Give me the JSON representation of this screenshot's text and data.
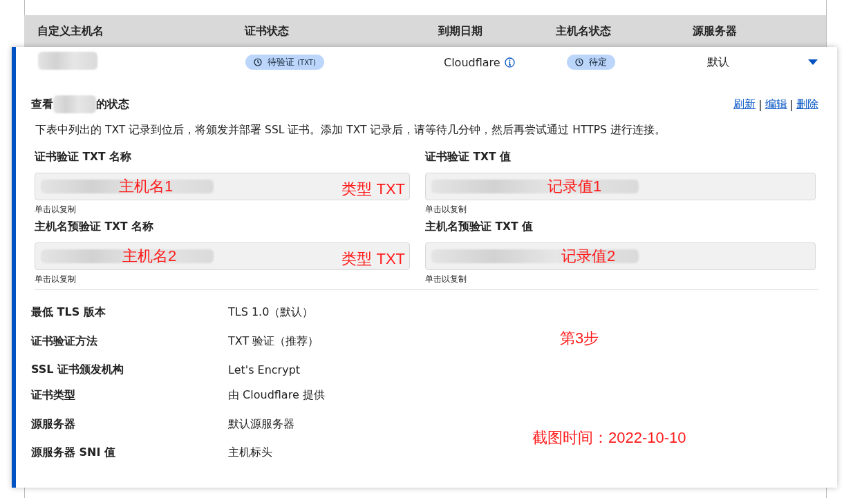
{
  "table": {
    "columns": [
      "自定义主机名",
      "证书状态",
      "到期日期",
      "主机名状态",
      "源服务器"
    ]
  },
  "row": {
    "cert_status": "待验证",
    "cert_status_suffix": "(TXT)",
    "expiry": "Cloudflare",
    "hostname_status": "待定",
    "origin": "默认",
    "expanded": true
  },
  "details": {
    "title_prefix": "查看",
    "title_suffix": "的状态",
    "actions": [
      "刷新",
      "编辑",
      "删除"
    ],
    "separator": "|",
    "description": "下表中列出的 TXT 记录到位后，将颁发并部署 SSL 证书。添加 TXT 记录后，请等待几分钟，然后再尝试通过 HTTPS 进行连接。",
    "fields": [
      {
        "label": "证书验证 TXT 名称",
        "note": "主机名1",
        "type_note": "类型 TXT",
        "hint": "单击以复制"
      },
      {
        "label": "证书验证 TXT 值",
        "note": "记录值1",
        "hint": "单击以复制"
      },
      {
        "label": "主机名预验证 TXT 名称",
        "note": "主机名2",
        "type_note": "类型 TXT",
        "hint": "单击以复制"
      },
      {
        "label": "主机名预验证 TXT 值",
        "note": "记录值2",
        "hint": "单击以复制"
      }
    ],
    "info": [
      {
        "label": "最低 TLS 版本",
        "value": "TLS 1.0（默认）"
      },
      {
        "label": "证书验证方法",
        "value": "TXT 验证（推荐）",
        "note": "第3步"
      },
      {
        "label": "SSL 证书颁发机构",
        "value": "Let's Encrypt"
      },
      {
        "label": "证书类型",
        "value": "由 Cloudflare 提供"
      },
      {
        "label": "源服务器",
        "value": "默认源服务器",
        "note": "截图时间：2022-10-10"
      },
      {
        "label": "源服务器 SNI 值",
        "value": "主机标头"
      }
    ]
  }
}
